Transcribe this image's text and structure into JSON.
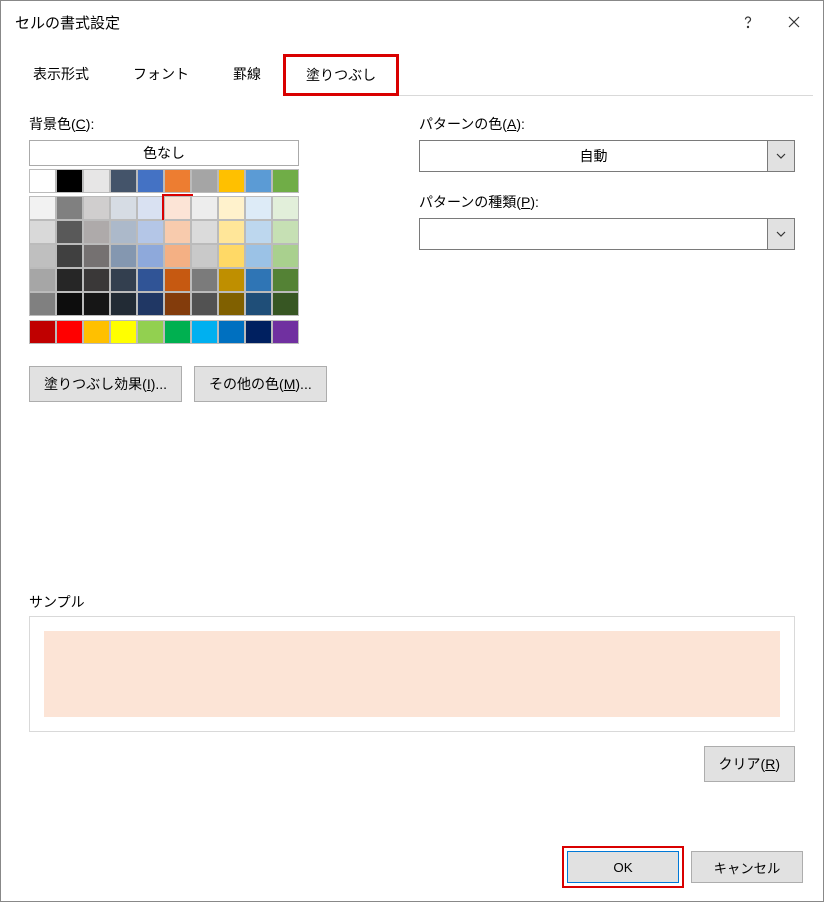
{
  "title": "セルの書式設定",
  "tabs": [
    "表示形式",
    "フォント",
    "罫線",
    "塗りつぶし"
  ],
  "activeTab": 3,
  "bgColor": {
    "label": "背景色(C):",
    "noColor": "色なし"
  },
  "patternColor": {
    "label": "パターンの色(A):",
    "value": "自動"
  },
  "patternStyle": {
    "label": "パターンの種類(P):",
    "value": ""
  },
  "fillEffects": "塗りつぶし効果(I)...",
  "moreColors": "その他の色(M)...",
  "sampleLabel": "サンプル",
  "sampleColor": "#fce4d6",
  "clearBtn": "クリア(R)",
  "okBtn": "OK",
  "cancelBtn": "キャンセル",
  "paletteTop": [
    "#ffffff",
    "#000000",
    "#e7e6e6",
    "#44546a",
    "#4472c4",
    "#ed7d31",
    "#a5a5a5",
    "#ffc000",
    "#5b9bd5",
    "#70ad47"
  ],
  "paletteGrid": [
    [
      "#f2f2f2",
      "#808080",
      "#d0cece",
      "#d6dce4",
      "#d9e1f2",
      "#fce4d6",
      "#ededed",
      "#fff2cc",
      "#ddebf7",
      "#e2efda"
    ],
    [
      "#d9d9d9",
      "#595959",
      "#aeaaaa",
      "#acb9ca",
      "#b4c6e7",
      "#f8cbad",
      "#dbdbdb",
      "#ffe699",
      "#bdd7ee",
      "#c6e0b4"
    ],
    [
      "#bfbfbf",
      "#404040",
      "#757171",
      "#8497b0",
      "#8ea9db",
      "#f4b084",
      "#c9c9c9",
      "#ffd966",
      "#9bc2e6",
      "#a9d08e"
    ],
    [
      "#a6a6a6",
      "#262626",
      "#3a3838",
      "#333f4f",
      "#305496",
      "#c65911",
      "#7b7b7b",
      "#bf8f00",
      "#2f75b5",
      "#548235"
    ],
    [
      "#808080",
      "#0d0d0d",
      "#161616",
      "#222b35",
      "#203764",
      "#833c0c",
      "#525252",
      "#806000",
      "#1f4e78",
      "#375623"
    ]
  ],
  "standardColors": [
    "#c00000",
    "#ff0000",
    "#ffc000",
    "#ffff00",
    "#92d050",
    "#00b050",
    "#00b0f0",
    "#0070c0",
    "#002060",
    "#7030a0"
  ],
  "selectedSwatch": [
    0,
    5
  ]
}
